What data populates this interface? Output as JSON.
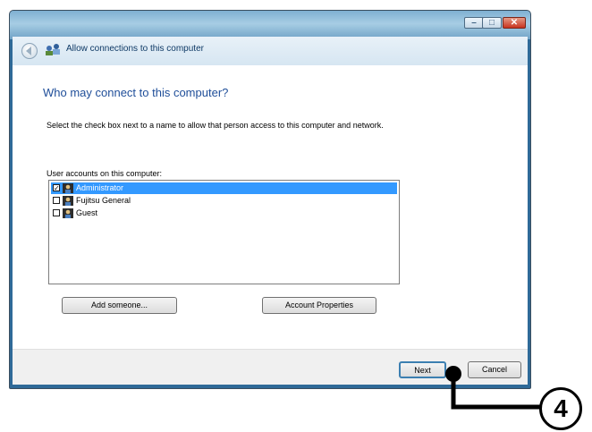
{
  "window": {
    "title": "Allow connections to this computer",
    "controls": {
      "minimize": "–",
      "maximize": "□",
      "close": "✕"
    }
  },
  "page": {
    "heading": "Who may connect to this computer?",
    "description": "Select the check box next to a name to allow that person access to this computer and network.",
    "list_label": "User accounts on this computer:",
    "users": [
      {
        "name": "Administrator",
        "checked": true,
        "selected": true
      },
      {
        "name": "Fujitsu General",
        "checked": false,
        "selected": false
      },
      {
        "name": "Guest",
        "checked": false,
        "selected": false
      }
    ],
    "add_button": "Add someone...",
    "properties_button": "Account Properties"
  },
  "footer": {
    "next_button": "Next",
    "cancel_button": "Cancel"
  },
  "callout": {
    "number": "4"
  },
  "icons": {
    "back": "back-arrow-icon",
    "title": "network-users-icon",
    "user": "user-account-icon"
  },
  "colors": {
    "selection": "#3399ff",
    "heading": "#1f4e99"
  }
}
